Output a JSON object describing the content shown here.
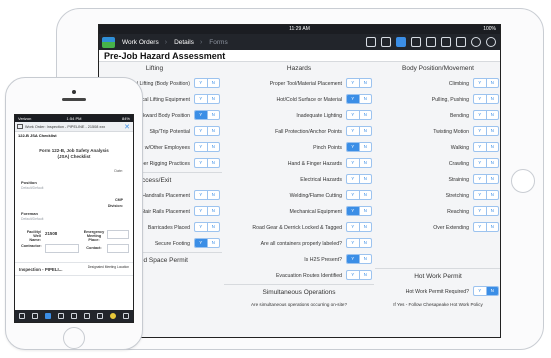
{
  "tablet": {
    "status": {
      "time": "11:29 AM",
      "battery": "100%"
    },
    "nav": {
      "work_orders": "Work Orders",
      "details": "Details",
      "forms": "Forms"
    },
    "page_title": "Pre-Job Hazard Assessment",
    "col1": {
      "lifting_header": "Lifting",
      "lifting": [
        {
          "label": "Manual Lifting (Body Position)",
          "sel": "none"
        },
        {
          "label": "Mechanical Lifting Equipment",
          "sel": "none"
        },
        {
          "label": "Awkward Body Position",
          "sel": "Y"
        },
        {
          "label": "Slip/Trip Potential",
          "sel": "none"
        },
        {
          "label": "Lifting w/Other Employees",
          "sel": "none"
        },
        {
          "label": "Proper Rigging Practices",
          "sel": "none"
        }
      ],
      "access_header": "Access/Exit",
      "access": [
        {
          "label": "Handrails Placement",
          "sel": "none"
        },
        {
          "label": "Steps/Stair Rails Placement",
          "sel": "none"
        },
        {
          "label": "Barricades Placed",
          "sel": "none"
        },
        {
          "label": "Secure Footing",
          "sel": "Y"
        }
      ],
      "confined_header": "Confined Space Permit"
    },
    "col2": {
      "hazards_header": "Hazards",
      "hazards": [
        {
          "label": "Proper Tool/Material Placement",
          "sel": "none"
        },
        {
          "label": "Hot/Cold Surface or Material",
          "sel": "Y"
        },
        {
          "label": "Inadequate Lighting",
          "sel": "none"
        },
        {
          "label": "Fall Protection/Anchor Points",
          "sel": "none"
        },
        {
          "label": "Pinch Points",
          "sel": "Y"
        },
        {
          "label": "Hand & Finger Hazards",
          "sel": "none"
        },
        {
          "label": "Electrical Hazards",
          "sel": "none"
        },
        {
          "label": "Welding/Flame Cutting",
          "sel": "none"
        },
        {
          "label": "Mechanical Equipment",
          "sel": "Y"
        },
        {
          "label": "Road Gear & Derrick Locked & Tagged",
          "sel": "none"
        },
        {
          "label": "Are all containers properly labeled?",
          "sel": "none"
        },
        {
          "label": "Is H2S Present?",
          "sel": "Y"
        },
        {
          "label": "Evacuation Routes Identified",
          "sel": "none"
        }
      ],
      "simops_header": "Simultaneous Operations",
      "simops_question": "Are simultaneous operations occurring on-site?"
    },
    "col3": {
      "body_header": "Body Position/Movement",
      "body": [
        {
          "label": "Climbing",
          "sel": "none"
        },
        {
          "label": "Pulling, Pushing",
          "sel": "none"
        },
        {
          "label": "Bending",
          "sel": "none"
        },
        {
          "label": "Twisting Motion",
          "sel": "none"
        },
        {
          "label": "Walking",
          "sel": "none"
        },
        {
          "label": "Crawling",
          "sel": "none"
        },
        {
          "label": "Straining",
          "sel": "none"
        },
        {
          "label": "Stretching",
          "sel": "none"
        },
        {
          "label": "Reaching",
          "sel": "none"
        },
        {
          "label": "Over Extending",
          "sel": "none"
        }
      ],
      "hot_header": "Hot Work Permit",
      "hot_question": {
        "label": "Hot Work Permit Required?",
        "sel": "N"
      },
      "hot_note": "If Yes - Follow Chesapeake Hot Work Policy"
    },
    "yes": "Y",
    "no": "N"
  },
  "phone": {
    "status": {
      "carrier": "Verizon",
      "time": "1:54 PM",
      "battery": "84%"
    },
    "header": "Work Order: Inspection - PIPELINE - 21508 xxx",
    "sub_title": "122-B JSA Checklist",
    "form_title_1": "Form 122-B, Job Safety Analysis",
    "form_title_2": "(JSA) Checklist",
    "date_label": "Date:",
    "position_label": "Position",
    "position_value": "Default/Default",
    "cmp_label": "CMP",
    "division_label": "Division:",
    "foreman_label": "Foreman",
    "foreman_value": "Default/Default",
    "facility_label": "Facility/ Well Name:",
    "facility_value": "21508",
    "emergency_label": "Emergency Meeting Place:",
    "contractor_label": "Contractor:",
    "contact_label": "Contact:",
    "inspection_label": "Inspection - PIPELI...",
    "inspection_right": "Designated Meeting Location"
  }
}
